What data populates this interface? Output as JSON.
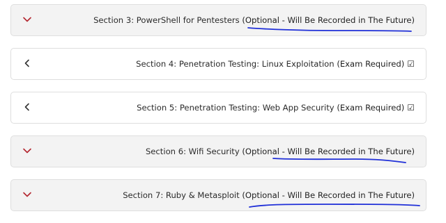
{
  "sections": [
    {
      "state": "expanded",
      "chevron": "chevron-down-icon",
      "title": "Section 3: PowerShell for Pentesters",
      "note": "(Optional - Will Be Recorded in The Future)",
      "check": ""
    },
    {
      "state": "collapsed",
      "chevron": "chevron-left-icon",
      "title": "Section 4: Penetration Testing: Linux Exploitation",
      "note": "(Exam Required)",
      "check": "☑"
    },
    {
      "state": "collapsed",
      "chevron": "chevron-left-icon",
      "title": "Section 5: Penetration Testing: Web App Security",
      "note": "(Exam Required)",
      "check": "☑"
    },
    {
      "state": "expanded",
      "chevron": "chevron-down-icon",
      "title": "Section 6: Wifi Security",
      "note": "(Optional - Will Be Recorded in The Future)",
      "check": ""
    },
    {
      "state": "expanded",
      "chevron": "chevron-down-icon",
      "title": "Section 7: Ruby & Metasploit",
      "note": "(Optional - Will Be Recorded in The Future)",
      "check": ""
    }
  ],
  "colors": {
    "chevron_expanded": "#b3262f",
    "chevron_collapsed": "#333333",
    "annotation_ink": "#1f2fd8"
  }
}
